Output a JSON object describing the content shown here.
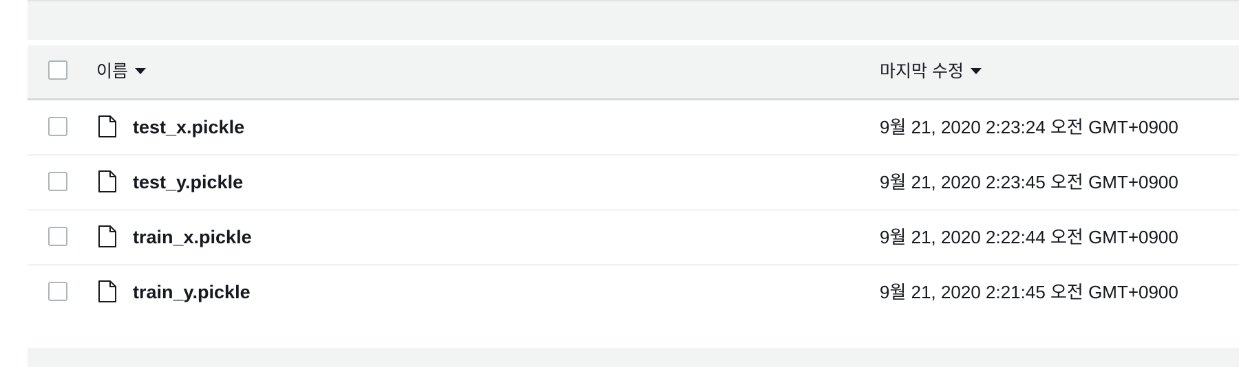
{
  "table": {
    "columns": {
      "name": "이름",
      "modified": "마지막 수정"
    },
    "rows": [
      {
        "name": "test_x.pickle",
        "modified": "9월 21, 2020 2:23:24 오전 GMT+0900",
        "icon": "file-icon"
      },
      {
        "name": "test_y.pickle",
        "modified": "9월 21, 2020 2:23:45 오전 GMT+0900",
        "icon": "file-icon"
      },
      {
        "name": "train_x.pickle",
        "modified": "9월 21, 2020 2:22:44 오전 GMT+0900",
        "icon": "file-icon"
      },
      {
        "name": "train_y.pickle",
        "modified": "9월 21, 2020 2:21:45 오전 GMT+0900",
        "icon": "file-icon"
      }
    ]
  },
  "colors": {
    "header_bg": "#f2f3f3",
    "border": "#d5dbdb",
    "checkbox_border": "#aab7b8",
    "text": "#16191f"
  }
}
